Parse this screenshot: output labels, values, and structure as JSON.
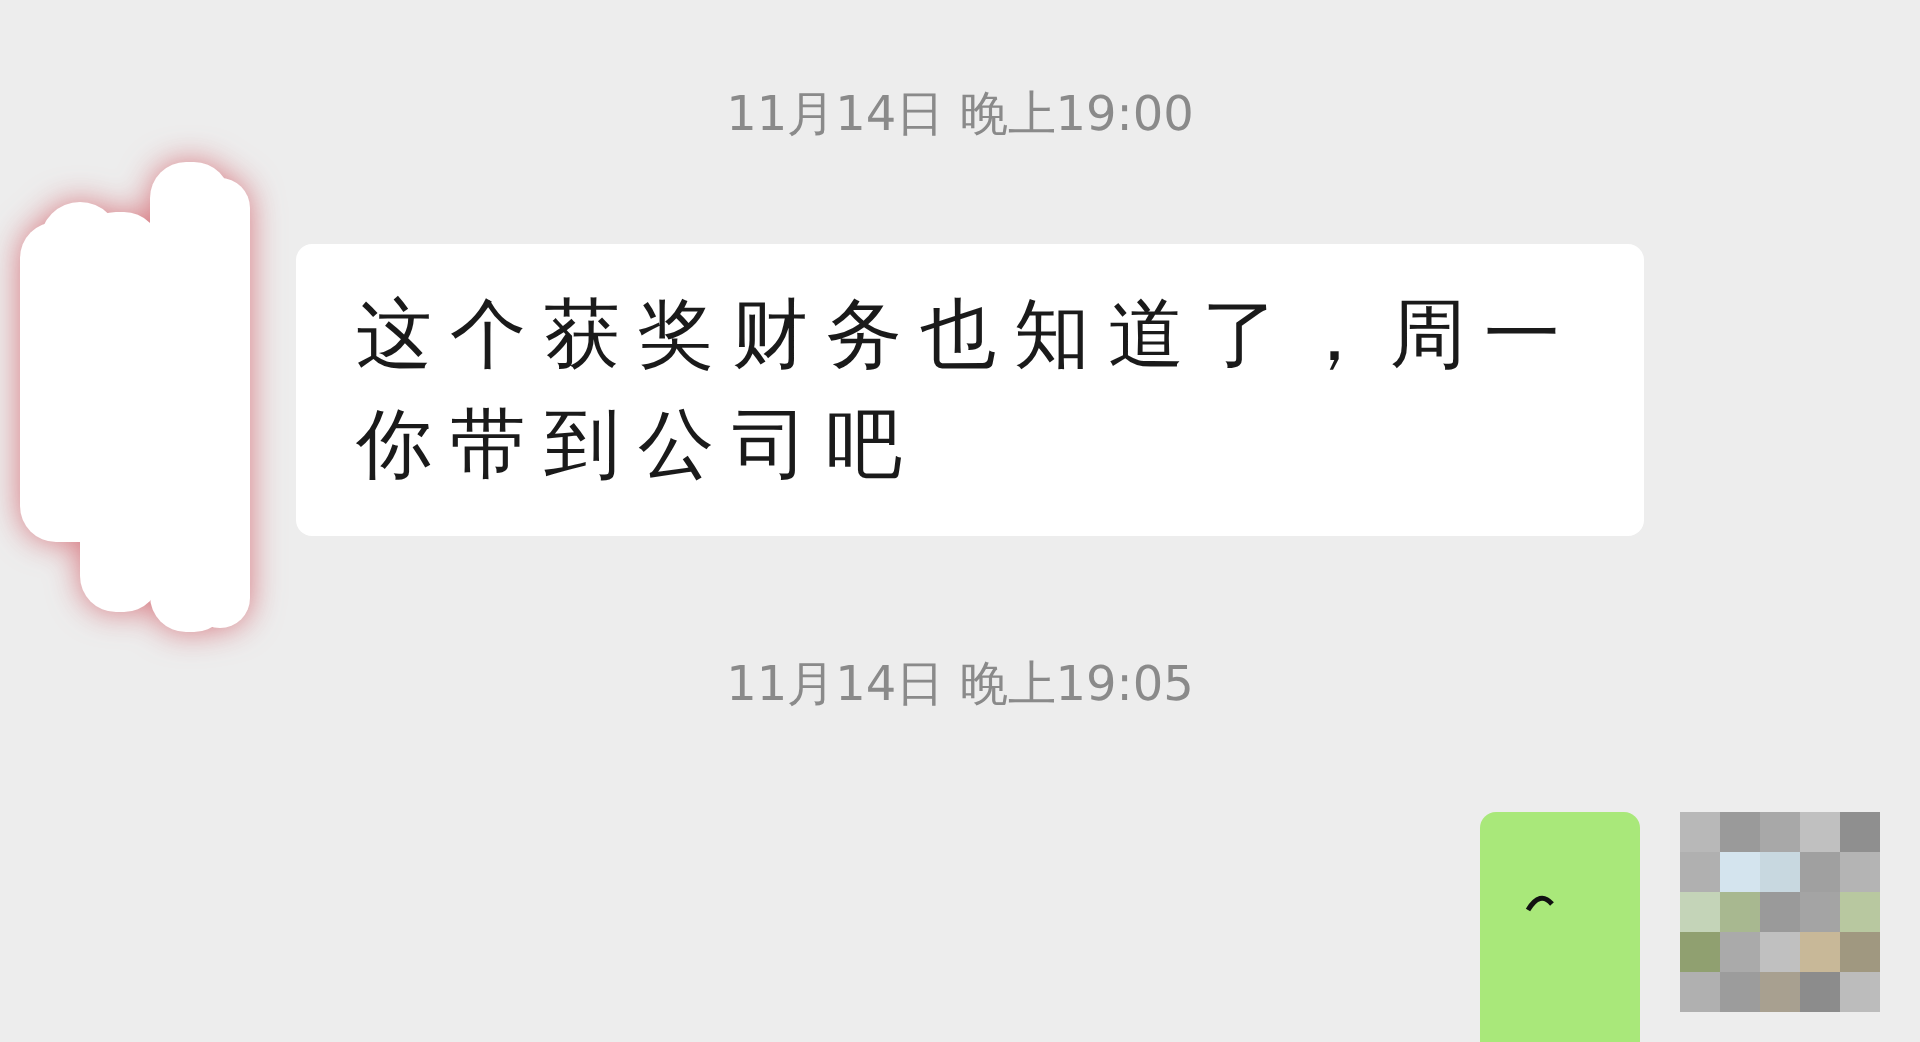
{
  "messages": [
    {
      "kind": "time",
      "text": "11月14日 晚上19:00"
    },
    {
      "kind": "incoming",
      "text": "这个获奖财务也知道了，周一你带到公司吧"
    },
    {
      "kind": "time",
      "text": "11月14日 晚上19:05"
    },
    {
      "kind": "outgoing"
    }
  ]
}
